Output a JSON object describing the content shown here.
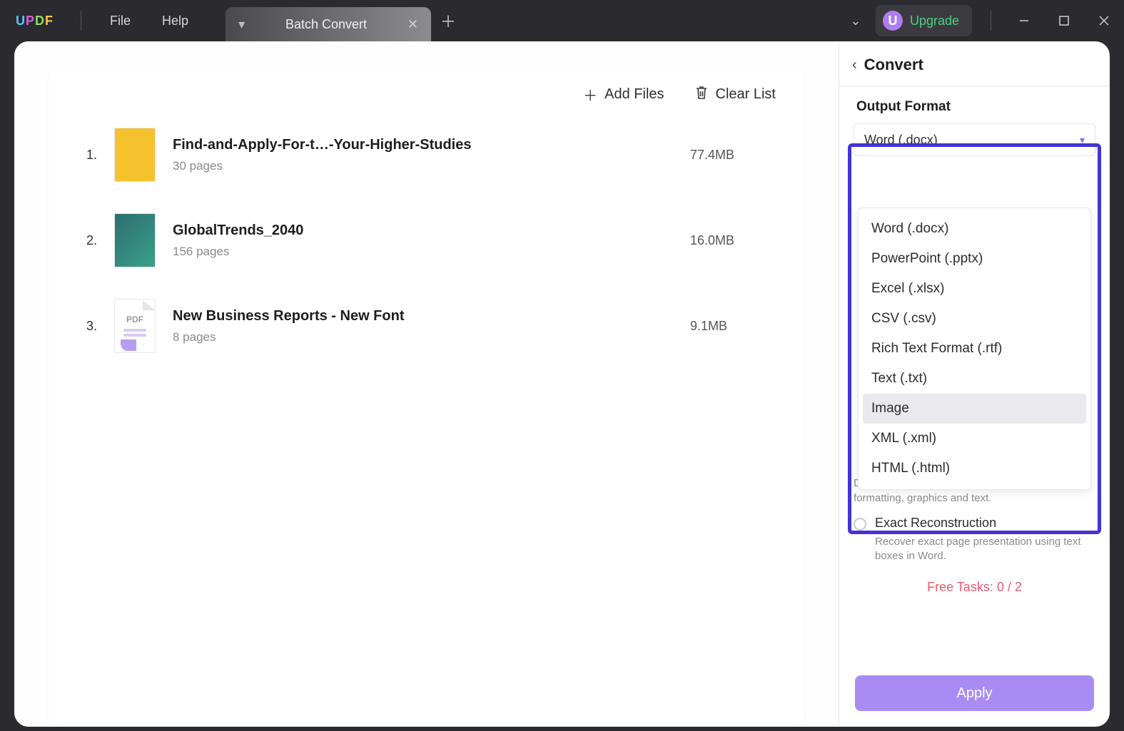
{
  "titlebar": {
    "logo": "UPDF",
    "menus": {
      "file": "File",
      "help": "Help"
    },
    "tab": {
      "title": "Batch Convert"
    },
    "upgrade": {
      "badge": "U",
      "label": "Upgrade"
    }
  },
  "toolbar": {
    "add_files": "Add Files",
    "clear_list": "Clear List"
  },
  "files": [
    {
      "index": "1.",
      "name": "Find-and-Apply-For-t…-Your-Higher-Studies",
      "pages": "30 pages",
      "size": "77.4MB",
      "thumb": "yellow"
    },
    {
      "index": "2.",
      "name": "GlobalTrends_2040",
      "pages": "156 pages",
      "size": "16.0MB",
      "thumb": "teal"
    },
    {
      "index": "3.",
      "name": "New Business Reports - New Font",
      "pages": "8 pages",
      "size": "9.1MB",
      "thumb": "pdf"
    }
  ],
  "side": {
    "title": "Convert",
    "section_output_format": "Output Format",
    "selected_format": "Word (.docx)",
    "format_options": [
      "Word (.docx)",
      "PowerPoint (.pptx)",
      "Excel (.xlsx)",
      "CSV (.csv)",
      "Rich Text Format (.rtf)",
      "Text (.txt)",
      "Image",
      "XML (.xml)",
      "HTML (.html)"
    ],
    "hovered_option_index": 6,
    "retain_desc": "Detect layout and columns but only recover formatting, graphics and text.",
    "exact_label": "Exact Reconstruction",
    "exact_desc": "Recover exact page presentation using text boxes in Word.",
    "free_tasks": "Free Tasks: 0 / 2",
    "apply": "Apply"
  }
}
